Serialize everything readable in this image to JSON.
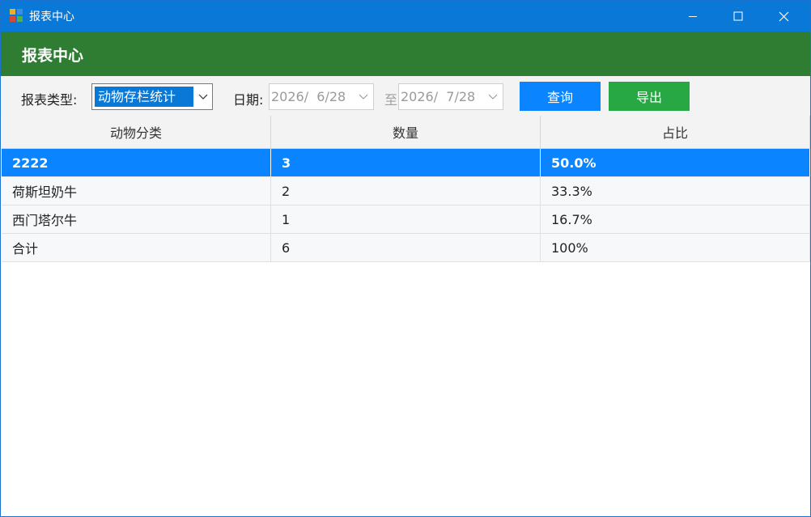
{
  "window": {
    "title": "报表中心",
    "accent": "#0a78d7"
  },
  "header": {
    "title": "报表中心",
    "color": "#2e7d32"
  },
  "toolbar": {
    "report_type_label": "报表类型:",
    "report_type_value": "动物存栏统计",
    "date_label": "日期:",
    "date_from": "2026/  6/28",
    "to_label": "至",
    "date_to": "2026/  7/28",
    "query_label": "查询",
    "export_label": "导出"
  },
  "table": {
    "columns": [
      "动物分类",
      "数量",
      "占比"
    ],
    "rows": [
      {
        "category": "2222",
        "count": "3",
        "ratio": "50.0%",
        "selected": true
      },
      {
        "category": "荷斯坦奶牛",
        "count": "2",
        "ratio": "33.3%"
      },
      {
        "category": "西门塔尔牛",
        "count": "1",
        "ratio": "16.7%"
      },
      {
        "category": "合计",
        "count": "6",
        "ratio": "100%"
      }
    ]
  },
  "icons": [
    "app-icon",
    "minimize-icon",
    "maximize-icon",
    "close-icon",
    "chevron-down-icon"
  ]
}
